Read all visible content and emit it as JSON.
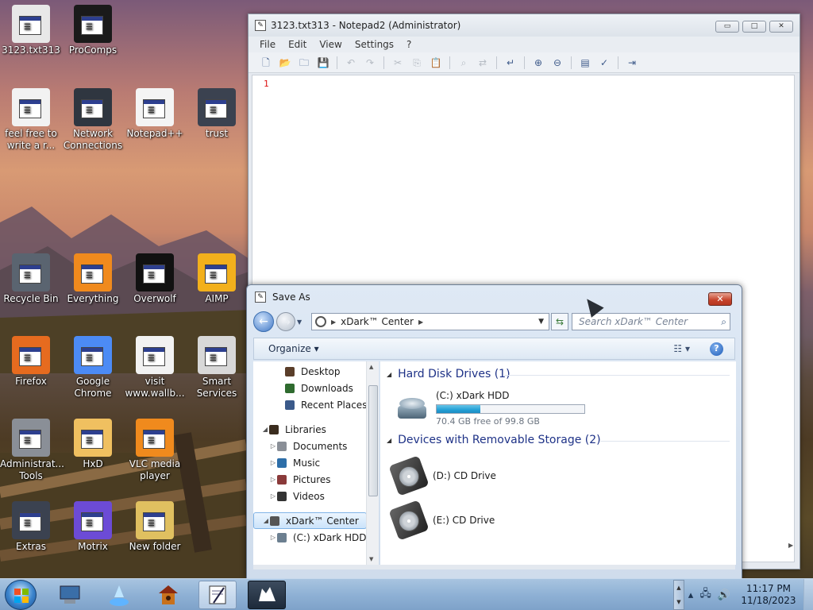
{
  "desktop": {
    "icons": [
      {
        "label": "3123.txt313",
        "icon": "document-icon",
        "color": "#e8e8e8"
      },
      {
        "label": "ProComps",
        "icon": "procomps-icon",
        "color": "#1a1a1a"
      },
      {
        "label": "feel free to write a r...",
        "icon": "text-file-icon",
        "color": "#f2f2f2"
      },
      {
        "label": "Network Connections",
        "icon": "network-icon",
        "color": "#2f3640"
      },
      {
        "label": "Notepad++",
        "icon": "notepadpp-icon",
        "color": "#f4f4f4"
      },
      {
        "label": "trust",
        "icon": "folder-icon",
        "color": "#3b4250"
      },
      {
        "label": "Recycle Bin",
        "icon": "recycle-bin-icon",
        "color": "#5a6470"
      },
      {
        "label": "Everything",
        "icon": "everything-icon",
        "color": "#f08a1d"
      },
      {
        "label": "Overwolf",
        "icon": "overwolf-icon",
        "color": "#111111"
      },
      {
        "label": "AIMP",
        "icon": "aimp-icon",
        "color": "#f2b01c"
      },
      {
        "label": "Firefox",
        "icon": "firefox-icon",
        "color": "#e66b1f"
      },
      {
        "label": "Google Chrome",
        "icon": "chrome-icon",
        "color": "#4c8bf5"
      },
      {
        "label": "visit www.wallb...",
        "icon": "text-file-icon",
        "color": "#f2f2f2"
      },
      {
        "label": "Smart Services",
        "icon": "gear-icon",
        "color": "#d8d8d8"
      },
      {
        "label": "Administrat... Tools",
        "icon": "admin-tools-icon",
        "color": "#8a8f97"
      },
      {
        "label": "HxD",
        "icon": "hxd-icon",
        "color": "#f0c060"
      },
      {
        "label": "VLC media player",
        "icon": "vlc-icon",
        "color": "#f08a1d"
      },
      {
        "label": "Extras",
        "icon": "folder-icon",
        "color": "#3b4250"
      },
      {
        "label": "Motrix",
        "icon": "motrix-icon",
        "color": "#6c4bd6"
      },
      {
        "label": "New folder",
        "icon": "folder-icon",
        "color": "#e0c060"
      }
    ]
  },
  "notepad": {
    "title": "3123.txt313 - Notepad2 (Administrator)",
    "menu": [
      "File",
      "Edit",
      "View",
      "Settings",
      "?"
    ],
    "line_number": "1",
    "window_buttons": {
      "minimize": "▭",
      "maximize": "□",
      "close": "✕"
    }
  },
  "save_as": {
    "title": "Save As",
    "close": "✕",
    "address": {
      "location": "xDark™ Center"
    },
    "search_placeholder": "Search xDark™ Center",
    "organize": "Organize ▾",
    "nav_items": [
      {
        "label": "Desktop",
        "icon": "desktop-icon",
        "color": "#5a3e2a"
      },
      {
        "label": "Downloads",
        "icon": "downloads-icon",
        "color": "#2f6b2f"
      },
      {
        "label": "Recent Places",
        "icon": "recent-places-icon",
        "color": "#3b5a8a"
      },
      {
        "label": "Libraries",
        "icon": "libraries-icon",
        "color": "#3a2c1e"
      },
      {
        "label": "Documents",
        "icon": "documents-icon",
        "color": "#8a8f97"
      },
      {
        "label": "Music",
        "icon": "music-icon",
        "color": "#2d6ea8"
      },
      {
        "label": "Pictures",
        "icon": "pictures-icon",
        "color": "#8a3a3a"
      },
      {
        "label": "Videos",
        "icon": "videos-icon",
        "color": "#333333"
      },
      {
        "label": "xDark™ Center",
        "icon": "computer-icon",
        "color": "#555555"
      },
      {
        "label": "(C:) xDark HDD",
        "icon": "hdd-icon",
        "color": "#6c7f90"
      }
    ],
    "groups": [
      {
        "label": "Hard Disk Drives (1)"
      },
      {
        "label": "Devices with Removable Storage (2)"
      }
    ],
    "drives": {
      "c": {
        "label": "(C:) xDark HDD",
        "free": "70.4 GB free of 99.8 GB",
        "used_fraction": 0.295
      },
      "d": {
        "label": "(D:) CD Drive"
      },
      "e": {
        "label": "(E:) CD Drive"
      }
    }
  },
  "taskbar": {
    "clock_time": "11:17 PM",
    "clock_date": "11/18/2023",
    "items": [
      "computer-icon",
      "launcher-icon",
      "birdhouse-icon",
      "notepad2-icon",
      "overwolf-icon"
    ]
  }
}
